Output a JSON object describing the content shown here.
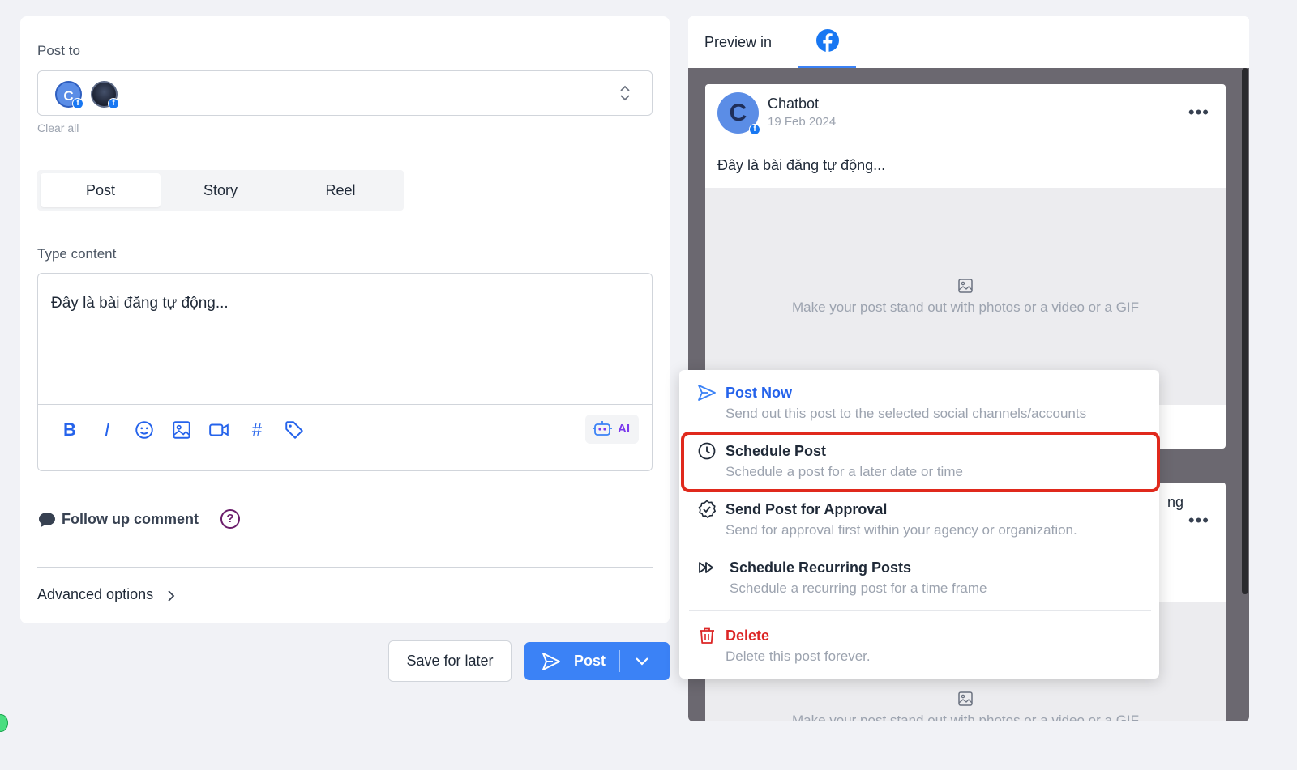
{
  "editor": {
    "post_to_label": "Post to",
    "avatars": [
      {
        "initial": "C",
        "network_badge": "f"
      },
      {
        "initial": "",
        "network_badge": "f"
      }
    ],
    "clear_all": "Clear all",
    "post_types": [
      "Post",
      "Story",
      "Reel"
    ],
    "active_post_type": "Post",
    "type_content_label": "Type content",
    "content_value": "Đây là bài đăng tự động...",
    "toolbar": {
      "bold": "B",
      "italic": "I",
      "emoji_icon": "emoji-icon",
      "image_icon": "image-icon",
      "video_icon": "video-icon",
      "hashtag": "#",
      "tag_icon": "tag-icon",
      "ai_label": "AI"
    },
    "follow_up_label": "Follow up comment",
    "help_glyph": "?",
    "advanced_options": "Advanced options"
  },
  "actions": {
    "save_for_later": "Save for later",
    "post": "Post"
  },
  "preview": {
    "label": "Preview in",
    "network": "facebook",
    "post": {
      "avatar_initial": "C",
      "badge": "f",
      "name": "Chatbot",
      "date": "19 Feb 2024",
      "more": "•••",
      "text": "Đây là bài đăng tự động...",
      "media_hint": "Make your post stand out with photos or a video or a GIF"
    },
    "post2": {
      "name_fragment": "ng",
      "more": "•••",
      "media_hint": "Make your post stand out with photos or a video or a GIF"
    }
  },
  "post_menu": {
    "items": [
      {
        "title": "Post Now",
        "description": "Send out this post to the selected social channels/accounts",
        "icon": "send-icon"
      },
      {
        "title": "Schedule Post",
        "description": "Schedule a post for a later date or time",
        "icon": "clock-icon"
      },
      {
        "title": "Send Post for Approval",
        "description": "Send for approval first within your agency or organization.",
        "icon": "approval-badge-icon"
      },
      {
        "title": "Schedule Recurring Posts",
        "description": "Schedule a recurring post for a time frame",
        "icon": "fast-forward-icon"
      },
      {
        "title": "Delete",
        "description": "Delete this post forever.",
        "icon": "trash-icon"
      }
    ],
    "highlighted_item": "Schedule Post"
  },
  "colors": {
    "accent": "#3b82f6",
    "danger": "#dc2626",
    "highlight_border": "#e0291c",
    "ai": "#7c3aed"
  }
}
